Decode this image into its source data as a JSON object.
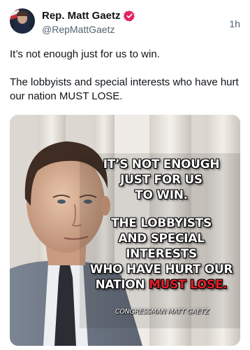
{
  "tweet": {
    "author": {
      "display_name": "Rep. Matt Gaetz",
      "handle": "@RepMattGaetz",
      "verified_icon": "verified-badge-icon",
      "verified_color": "#1d9bf0"
    },
    "time": "1h",
    "text": [
      "It’s not enough just for us to win.",
      "The lobbyists and special interests who have hurt our nation MUST LOSE."
    ],
    "media": {
      "caption_lines": [
        "IT’S NOT ENOUGH",
        "JUST FOR US",
        "TO WIN.",
        "THE LOBBYISTS",
        "AND SPECIAL INTERESTS",
        "WHO HAVE HURT OUR",
        "NATION",
        "MUST LOSE."
      ],
      "attribution": "CONGRESSMAN MATT GAETZ",
      "accent_color": "#e0202a"
    }
  }
}
